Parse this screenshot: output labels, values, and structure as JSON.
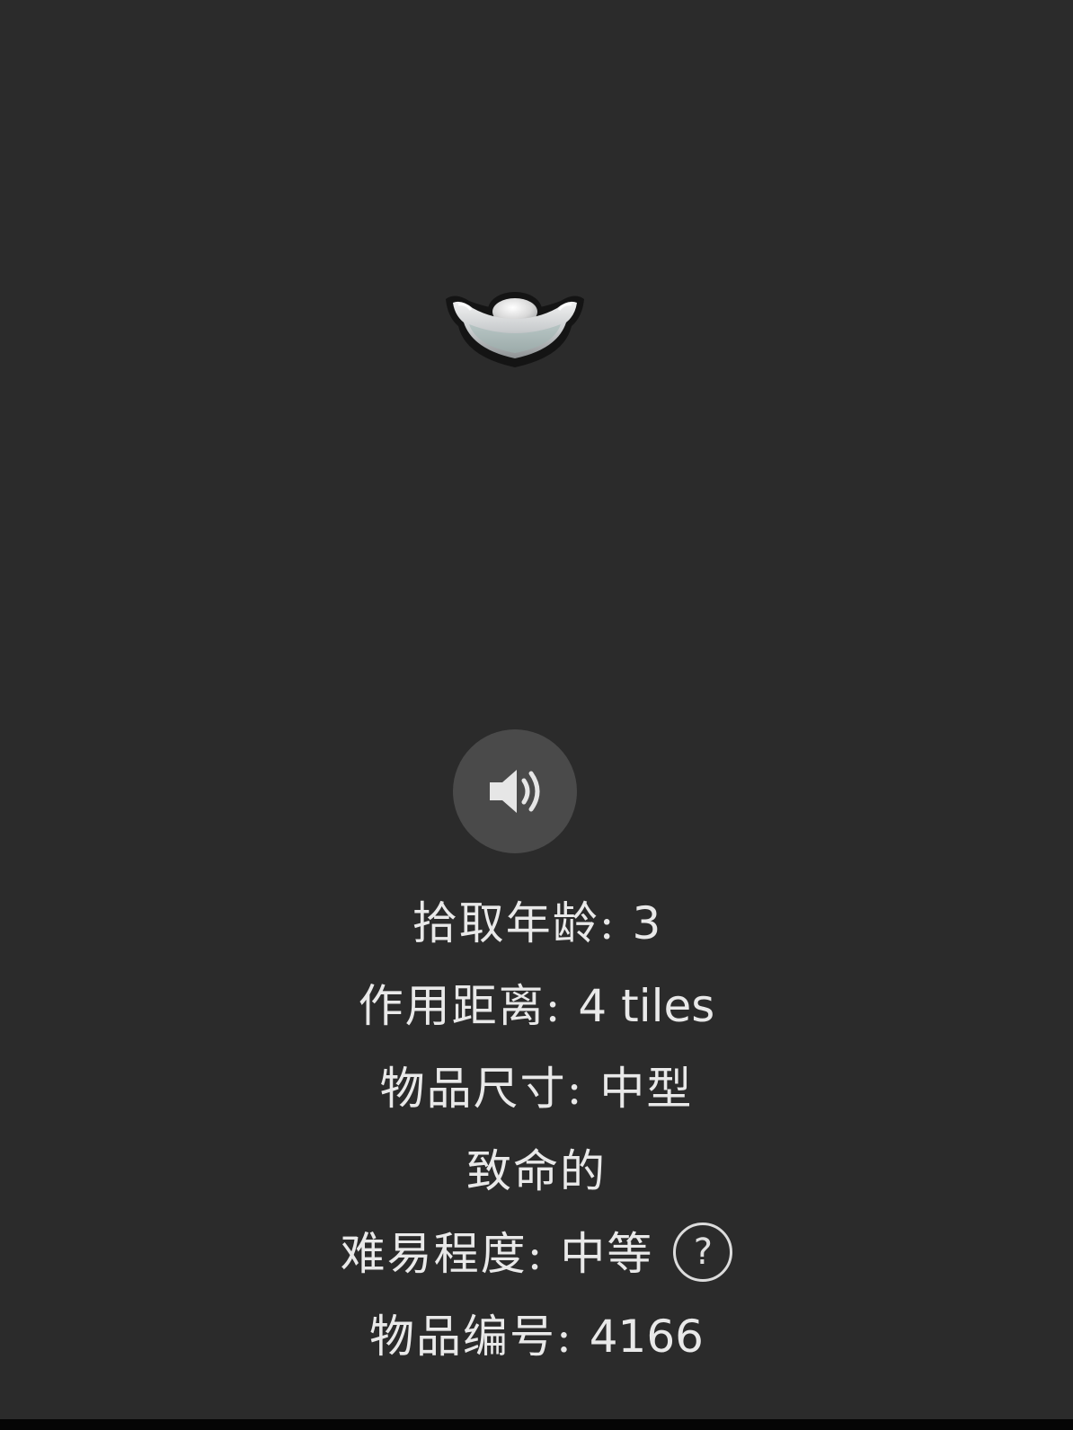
{
  "item": {
    "image_name": "silver-ingot-icon"
  },
  "sound_button": {
    "icon": "speaker-icon"
  },
  "info": {
    "pickup_age": {
      "label": "拾取年龄: ",
      "value": "3"
    },
    "range": {
      "label": "作用距离: ",
      "value": "4 tiles"
    },
    "size": {
      "label": "物品尺寸: ",
      "value": "中型"
    },
    "deadly": "致命的",
    "difficulty": {
      "label": "难易程度: ",
      "value": "中等",
      "help_icon": "?"
    },
    "item_id": {
      "label": "物品编号: ",
      "value": "4166"
    }
  },
  "colors": {
    "background": "#2b2b2b",
    "button": "#4a4a4a",
    "text": "#e9e9e9"
  }
}
